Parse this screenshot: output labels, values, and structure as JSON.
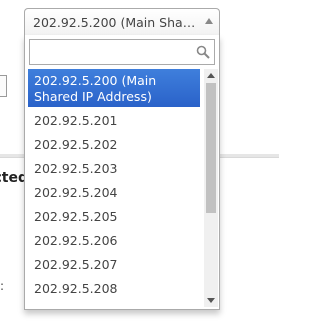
{
  "select": {
    "selected": "202.92.5.200 (Main Shared IP Address)"
  },
  "search": {
    "placeholder": "",
    "value": ""
  },
  "options": [
    "202.92.5.200 (Main Shared IP Address)",
    "202.92.5.201",
    "202.92.5.202",
    "202.92.5.203",
    "202.92.5.204",
    "202.92.5.205",
    "202.92.5.206",
    "202.92.5.207",
    "202.92.5.208"
  ],
  "highlight_color": "#3875d7",
  "background": {
    "heading_fragment": "ected",
    "marker_fragment": ":"
  },
  "icons": {
    "search": "search-icon",
    "dropdown_arrow": "chevron-up-icon"
  }
}
